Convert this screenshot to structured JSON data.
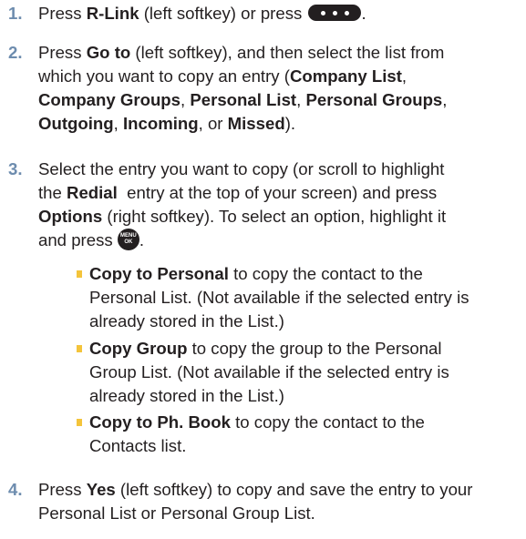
{
  "steps": [
    {
      "number": "1.",
      "lines": {
        "l1_a": "Press ",
        "l1_b": "R-Link",
        "l1_c": " (left softkey) or press ",
        "l1_d": "."
      }
    },
    {
      "number": "2.",
      "lines": {
        "l1_a": "Press ",
        "l1_b": "Go to",
        "l1_c": " (left softkey), and then select the list from",
        "l2": "which you want to copy an entry (",
        "l2_b": "Company List",
        "l2_c": ",",
        "l3_a": "Company Groups",
        "l3_b": ", ",
        "l3_c": "Personal List",
        "l3_d": ", ",
        "l3_e": "Personal Groups",
        "l3_f": ",",
        "l4_a": "Outgoing",
        "l4_b": ", ",
        "l4_c": "Incoming",
        "l4_d": ", or ",
        "l4_e": "Missed",
        "l4_f": ")."
      }
    },
    {
      "number": "3.",
      "lines": {
        "l1": "Select the entry you want to copy (or scroll to highlight",
        "l2_a": "the ",
        "l2_b": "Redial",
        "l2_c": "  entry at the top of your screen) and press",
        "l3_a": "Options",
        "l3_b": " (right softkey). To select an option, highlight it",
        "l4_a": "and press ",
        "l4_b": "."
      },
      "menu_key": {
        "top": "MENU",
        "bottom": "OK"
      }
    },
    {
      "number": "4.",
      "lines": {
        "l1_a": "Press ",
        "l1_b": "Yes",
        "l1_c": " (left softkey) to copy and save the entry to your",
        "l2": "Personal List or Personal Group List."
      }
    }
  ],
  "options": [
    {
      "name": "Copy to Personal",
      "line1_rest": " to copy the contact to the",
      "line2": "Personal List. (Not available if the selected entry is",
      "line3": "already stored in the List.)"
    },
    {
      "name": "Copy Group",
      "line1_rest": " to copy the group to the Personal",
      "line2": "Group List. (Not available if the selected entry is",
      "line3": "already stored in the List.)"
    },
    {
      "name": "Copy to Ph. Book",
      "line1_rest": " to copy the contact to the",
      "line2": "Contacts list."
    }
  ],
  "colors": {
    "number": "#6d8cae",
    "bullet": "#f4c43b",
    "text": "#231f20"
  }
}
